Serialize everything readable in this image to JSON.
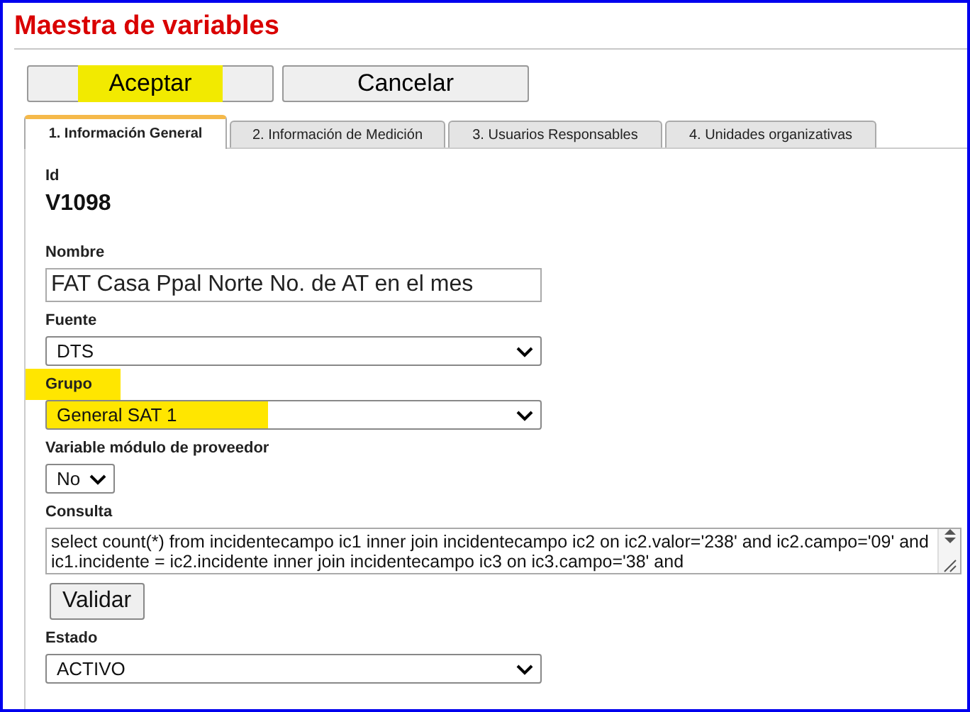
{
  "window": {
    "title": "Maestra de variables"
  },
  "buttons": [
    {
      "label": "Aceptar",
      "highlighted": true
    },
    {
      "label": "Cancelar",
      "highlighted": false
    }
  ],
  "tabs": [
    {
      "label": "1. Información General",
      "selected": true
    },
    {
      "label": "2. Información de Medición",
      "selected": false
    },
    {
      "label": "3. Usuarios Responsables",
      "selected": false
    },
    {
      "label": "4. Unidades organizativas",
      "selected": false
    }
  ],
  "fields": [
    {
      "kind": "static",
      "label": "Id",
      "value": "V1098"
    },
    {
      "kind": "text",
      "label": "Nombre",
      "value": "FAT Casa Ppal Norte No. de AT en el mes"
    },
    {
      "kind": "select",
      "label": "Fuente",
      "value": "DTS"
    },
    {
      "kind": "select",
      "label": "Grupo",
      "value": "General SAT 1",
      "highlighted": true
    },
    {
      "kind": "smallselect",
      "label": "Variable módulo de proveedor",
      "value": "No"
    },
    {
      "kind": "textarea",
      "label": "Consulta",
      "value": "select count(*) from incidentecampo ic1 inner join incidentecampo ic2 on ic2.valor='238' and ic2.campo='09' and ic1.incidente = ic2.incidente inner join incidentecampo ic3 on ic3.campo='38' and"
    },
    {
      "kind": "button",
      "label": "Validar"
    },
    {
      "kind": "select",
      "label": "Estado",
      "value": "ACTIVO"
    }
  ]
}
